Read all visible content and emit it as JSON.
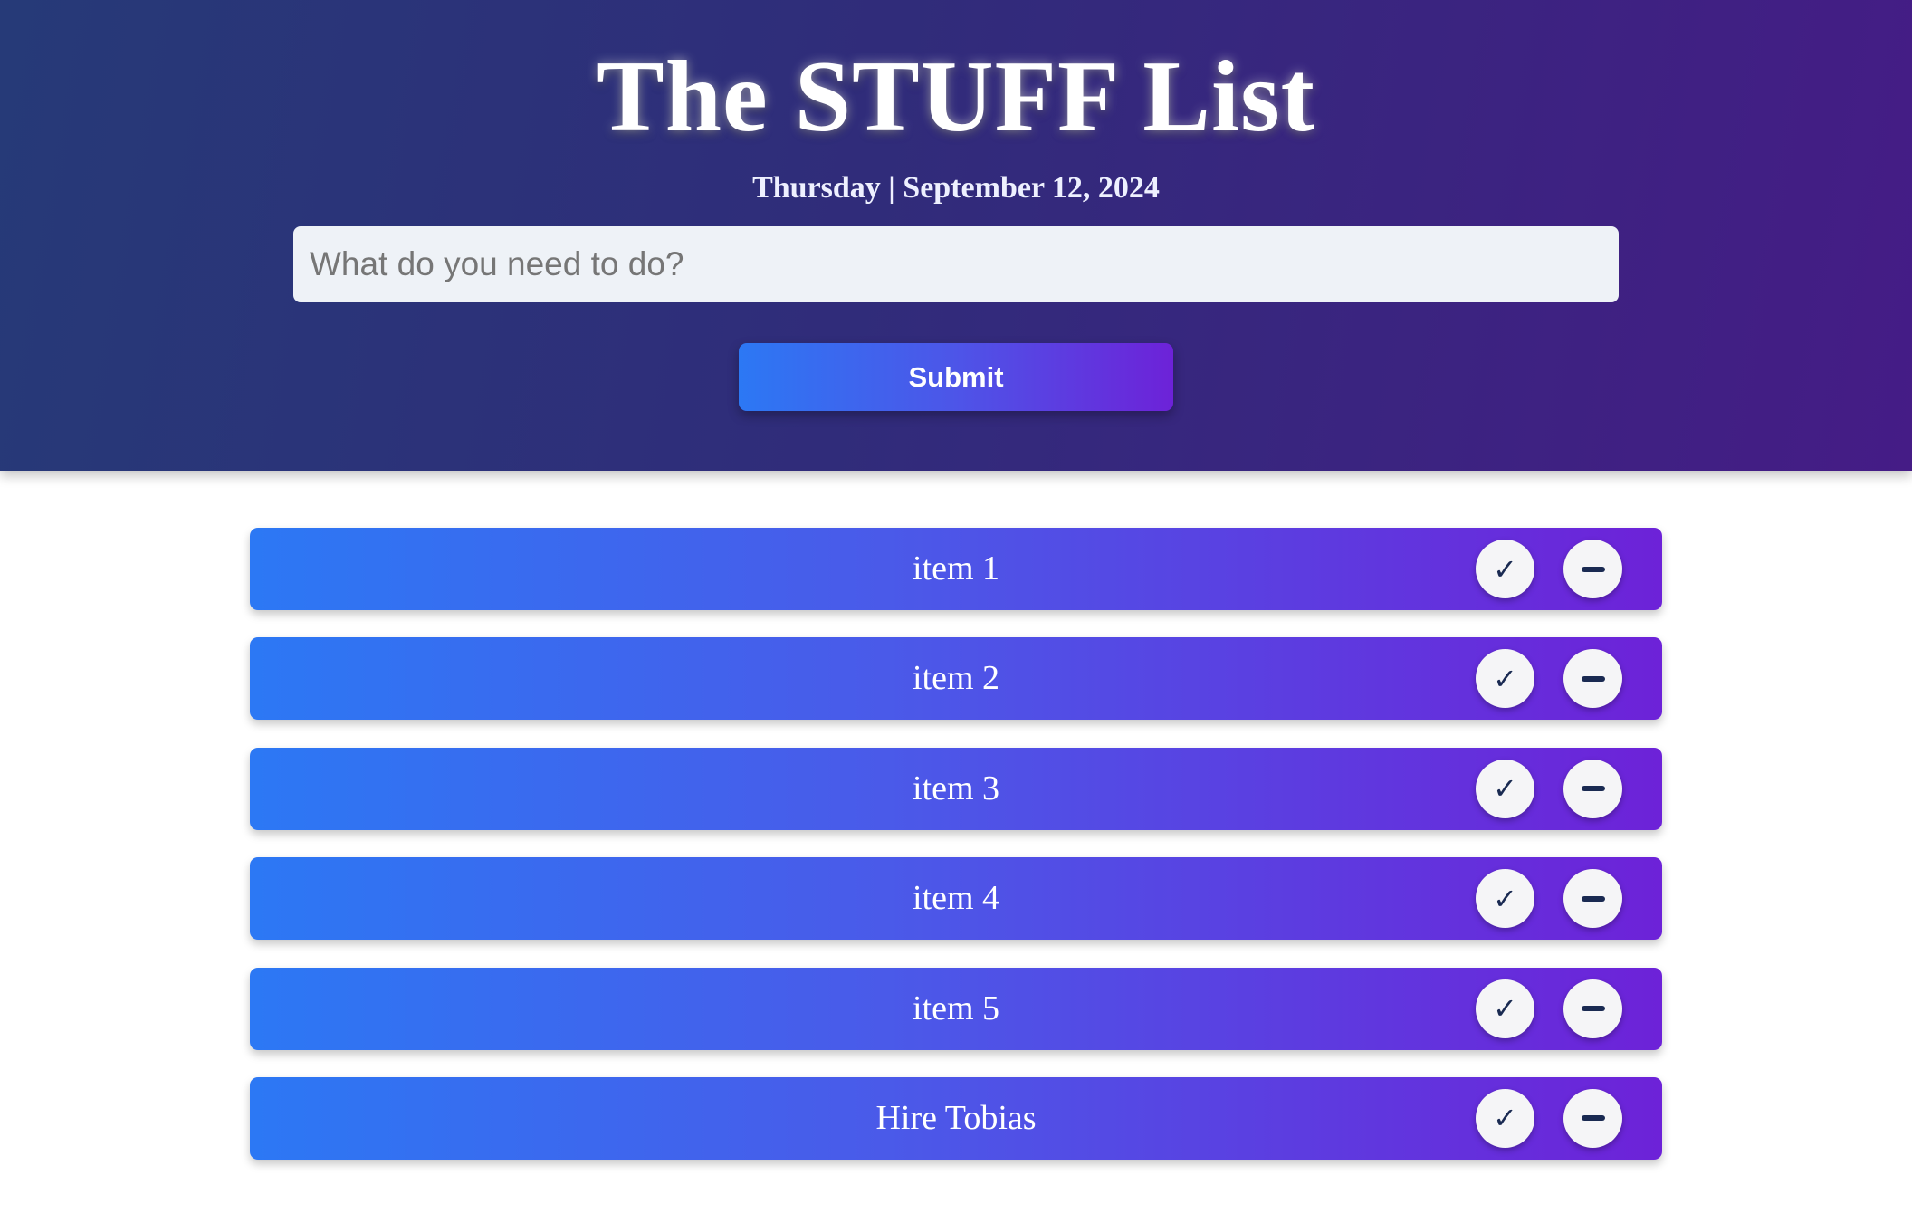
{
  "header": {
    "title": "The STUFF List",
    "date": "Thursday | September 12, 2024"
  },
  "form": {
    "placeholder": "What do you need to do?",
    "submit_label": "Submit"
  },
  "list": {
    "items": [
      {
        "text": "item 1"
      },
      {
        "text": "item 2"
      },
      {
        "text": "item 3"
      },
      {
        "text": "item 4"
      },
      {
        "text": "item 5"
      },
      {
        "text": "Hire Tobias"
      }
    ],
    "complete_icon": "check-icon",
    "remove_icon": "minus-icon",
    "complete_glyph": "✓"
  },
  "colors": {
    "header_gradient_start": "#263a78",
    "header_gradient_end": "#451c86",
    "accent_gradient_start": "#2c78f4",
    "accent_gradient_end": "#6d22d8",
    "icon_color": "#1a2a52"
  }
}
